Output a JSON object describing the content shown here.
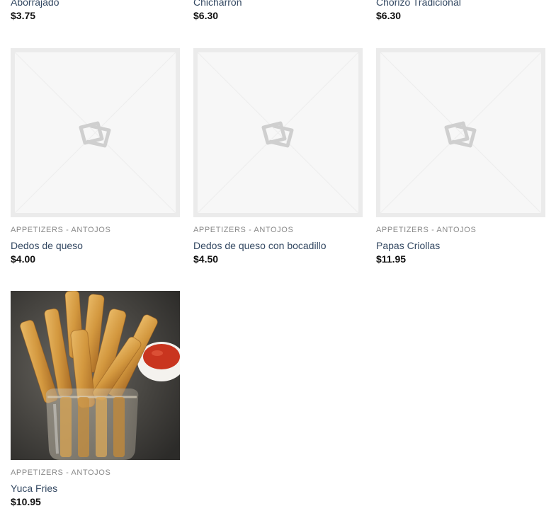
{
  "top_row": [
    {
      "name": "Aborrajado",
      "price": "$3.75"
    },
    {
      "name": "Chicharron",
      "price": "$6.30"
    },
    {
      "name": "Chorizo Tradicional",
      "price": "$6.30"
    }
  ],
  "middle_row": [
    {
      "category": "APPETIZERS - ANTOJOS",
      "name": "Dedos de queso",
      "price": "$4.00",
      "image": "placeholder-image-icon"
    },
    {
      "category": "APPETIZERS - ANTOJOS",
      "name": "Dedos de queso con bocadillo",
      "price": "$4.50",
      "image": "placeholder-image-icon"
    },
    {
      "category": "APPETIZERS - ANTOJOS",
      "name": "Papas Criollas",
      "price": "$11.95",
      "image": "placeholder-image-icon"
    }
  ],
  "bottom_row": [
    {
      "category": "APPETIZERS - ANTOJOS",
      "name": "Yuca Fries",
      "price": "$10.95",
      "image": "yuca-fries-photo"
    }
  ],
  "colors": {
    "link": "#334862",
    "price": "#111111",
    "category": "#8a8a8a",
    "placeholder_bg": "#f7f7f7",
    "placeholder_border": "#ebebeb"
  }
}
